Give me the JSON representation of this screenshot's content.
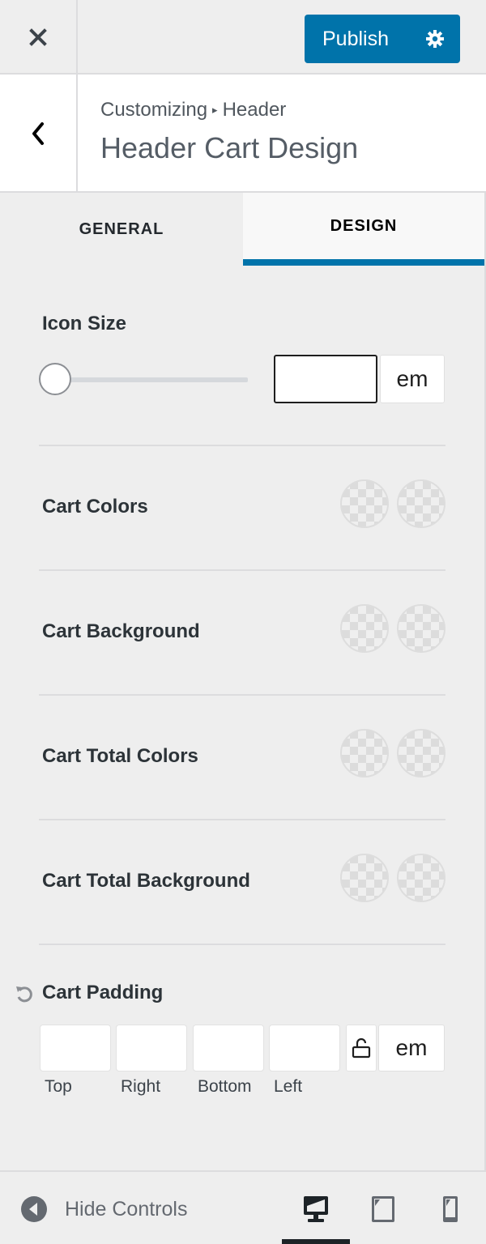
{
  "topbar": {
    "close_icon": "close-icon",
    "publish_label": "Publish",
    "settings_icon": "gear-icon"
  },
  "section": {
    "back_icon": "chevron-left-icon",
    "breadcrumb_root": "Customizing",
    "breadcrumb_separator": "▸",
    "breadcrumb_parent": "Header",
    "title": "Header Cart Design"
  },
  "tabs": [
    {
      "label": "GENERAL",
      "active": false
    },
    {
      "label": "DESIGN",
      "active": true
    }
  ],
  "controls": {
    "icon_size": {
      "label": "Icon Size",
      "value": "",
      "slider_fraction": 0,
      "unit": "em"
    },
    "colors": [
      {
        "label": "Cart Colors",
        "swatches": [
          "transparent",
          "transparent"
        ]
      },
      {
        "label": "Cart Background",
        "swatches": [
          "transparent",
          "transparent"
        ]
      },
      {
        "label": "Cart Total Colors",
        "swatches": [
          "transparent",
          "transparent"
        ]
      },
      {
        "label": "Cart Total Background",
        "swatches": [
          "transparent",
          "transparent"
        ]
      }
    ],
    "cart_padding": {
      "label": "Cart Padding",
      "reset_icon": "undo-icon",
      "fields": [
        {
          "label": "Top",
          "value": ""
        },
        {
          "label": "Right",
          "value": ""
        },
        {
          "label": "Bottom",
          "value": ""
        },
        {
          "label": "Left",
          "value": ""
        }
      ],
      "lock_icon": "unlock-icon",
      "unit": "em"
    }
  },
  "footer": {
    "hide_controls_label": "Hide Controls",
    "devices": [
      {
        "name": "desktop",
        "active": true
      },
      {
        "name": "tablet",
        "active": false
      },
      {
        "name": "mobile",
        "active": false
      }
    ]
  },
  "colors": {
    "accent": "#0073aa",
    "background": "#eeeeee"
  }
}
